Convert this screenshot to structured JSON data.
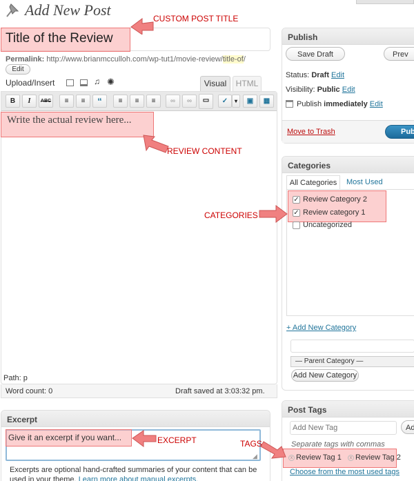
{
  "page": {
    "title": "Add New Post"
  },
  "annotations": {
    "title": "CUSTOM POST TITLE",
    "content": "REVIEW CONTENT",
    "categories": "CATEGORIES",
    "excerpt": "EXCERPT",
    "tags": "TAGS"
  },
  "post": {
    "title_value": "Title of the Review",
    "permalink_label": "Permalink:",
    "permalink_url": "http://www.brianmcculloh.com/wp-tut1/movie-review/",
    "permalink_slug": "title-of",
    "permalink_tail": "/",
    "edit_button": "Edit"
  },
  "editor": {
    "upload_label": "Upload/Insert",
    "tab_visual": "Visual",
    "tab_html": "HTML",
    "toolbar": [
      "B",
      "I",
      "ABC",
      "≡",
      "≡",
      "“",
      "≡",
      "≡",
      "≡",
      "∞",
      "∞",
      "▭",
      "✓",
      "▾",
      "▣",
      "▦"
    ],
    "content": "Write the actual review here...",
    "path": "Path: p",
    "word_count": "Word count: 0",
    "draft_saved": "Draft saved at 3:03:32 pm."
  },
  "publish": {
    "header": "Publish",
    "save_draft": "Save Draft",
    "preview": "Prev",
    "status_label": "Status:",
    "status_value": "Draft",
    "visibility_label": "Visibility:",
    "visibility_value": "Public",
    "publish_label": "Publish",
    "publish_value": "immediately",
    "edit": "Edit",
    "trash": "Move to Trash",
    "publish_button": "Pub"
  },
  "categories": {
    "header": "Categories",
    "tab_all": "All Categories",
    "tab_used": "Most Used",
    "items": [
      {
        "label": "Review Category 2",
        "checked": "✓"
      },
      {
        "label": "Review category 1",
        "checked": "✓"
      },
      {
        "label": "Uncategorized",
        "checked": ""
      }
    ],
    "add_new_link": "+ Add New Category",
    "parent_select": "— Parent Category —",
    "add_button": "Add New Category"
  },
  "excerpt": {
    "header": "Excerpt",
    "value": "Give it an excerpt if you want...",
    "help_text": "Excerpts are optional hand-crafted summaries of your content that can be used in your theme.",
    "help_link": "Learn more about manual excerpts."
  },
  "tags": {
    "header": "Post Tags",
    "placeholder": "Add New Tag",
    "add_button": "Ad",
    "hint": "Separate tags with commas",
    "items": [
      "Review Tag 1",
      "Review Tag 2"
    ],
    "most_used_link": "Choose from the most used tags"
  }
}
